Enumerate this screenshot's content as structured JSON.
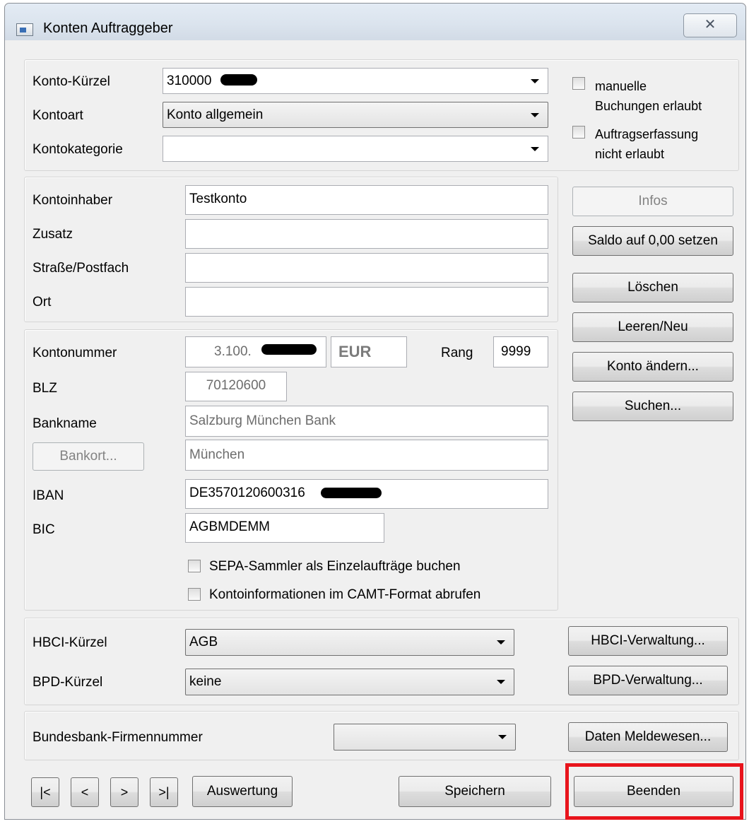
{
  "window": {
    "title": "Konten Auftraggeber",
    "close_symbol": "✕"
  },
  "account": {
    "kuerzel_label": "Konto-Kürzel",
    "kuerzel_value": "310000",
    "art_label": "Kontoart",
    "art_value": "Konto allgemein",
    "kategorie_label": "Kontokategorie",
    "kategorie_value": "",
    "manual_booking_label_1": "manuelle",
    "manual_booking_label_2": "Buchungen erlaubt",
    "order_entry_label_1": "Auftragserfassung",
    "order_entry_label_2": "nicht erlaubt"
  },
  "holder": {
    "inhaber_label": "Kontoinhaber",
    "inhaber_value": "Testkonto",
    "zusatz_label": "Zusatz",
    "zusatz_value": "",
    "strasse_label": "Straße/Postfach",
    "strasse_value": "",
    "ort_label": "Ort",
    "ort_value": ""
  },
  "bank": {
    "kontonummer_label": "Kontonummer",
    "kontonummer_value": "3.100.",
    "currency": "EUR",
    "rang_label": "Rang",
    "rang_value": "9999",
    "blz_label": "BLZ",
    "blz_value": "70120600",
    "bankname_label": "Bankname",
    "bankname_value": "Salzburg München Bank",
    "bankort_button": "Bankort...",
    "bankort_value": "München",
    "iban_label": "IBAN",
    "iban_value": "DE3570120600316",
    "bic_label": "BIC",
    "bic_value": "AGBMDEMM",
    "sepa_checkbox_label": "SEPA-Sammler als Einzelaufträge buchen",
    "camt_checkbox_label": "Kontoinformationen im CAMT-Format abrufen"
  },
  "side_buttons": {
    "infos": "Infos",
    "saldo": "Saldo auf 0,00 setzen",
    "loeschen": "Löschen",
    "leeren": "Leeren/Neu",
    "konto_aendern": "Konto ändern...",
    "suchen": "Suchen..."
  },
  "hbci": {
    "hbci_label": "HBCI-Kürzel",
    "hbci_value": "AGB",
    "hbci_button": "HBCI-Verwaltung...",
    "bpd_label": "BPD-Kürzel",
    "bpd_value": "keine",
    "bpd_button": "BPD-Verwaltung..."
  },
  "bundesbank": {
    "label": "Bundesbank-Firmennummer",
    "value": "",
    "button": "Daten Meldewesen..."
  },
  "footer": {
    "first": "|<",
    "prev": "<",
    "next": ">",
    "last": ">|",
    "auswertung": "Auswertung",
    "speichern": "Speichern",
    "beenden": "Beenden"
  },
  "colors": {
    "highlight": "#e8141c",
    "titlebar": "#dbe4ee",
    "dialog_bg": "#f0f0f0"
  }
}
